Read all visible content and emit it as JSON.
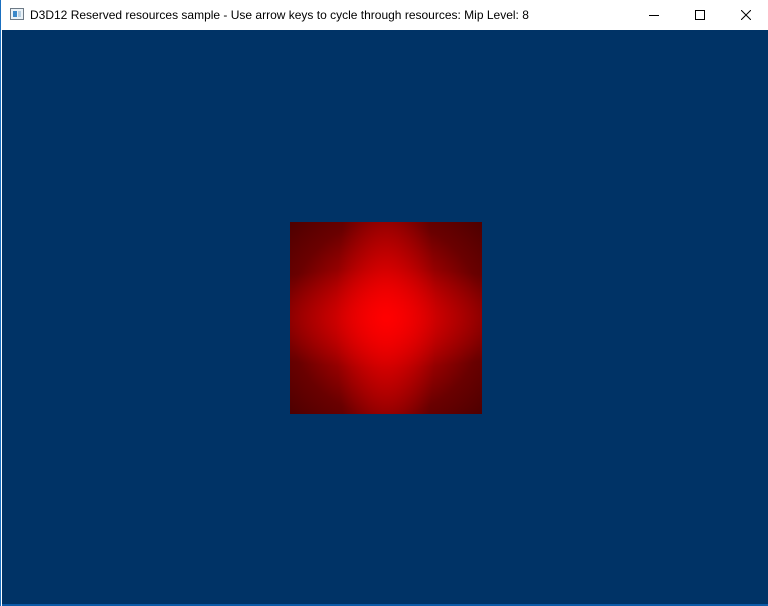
{
  "window": {
    "title": "D3D12 Reserved resources sample - Use arrow keys to cycle through resources: Mip Level: 8",
    "icon": "app-window-icon",
    "controls": {
      "minimize_icon": "minimize-icon",
      "maximize_icon": "maximize-icon",
      "close_icon": "close-icon"
    }
  },
  "scene": {
    "clear_color": "#003366",
    "texture_color": "#ff0000",
    "mip_level": 8
  }
}
